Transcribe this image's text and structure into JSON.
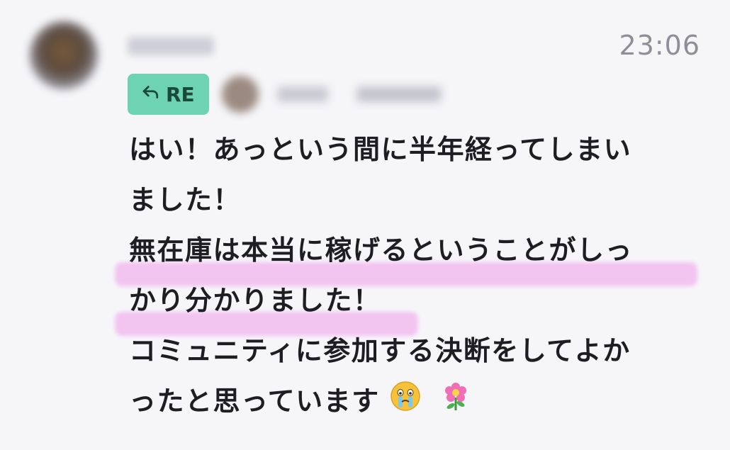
{
  "timestamp": "23:06",
  "reply_badge": {
    "label": "RE",
    "icon": "reply-arrow-icon",
    "color": "#6dd3b2"
  },
  "message": {
    "lines": [
      "はい！あっという間に半年経ってしまい",
      "ました！",
      "無在庫は本当に稼げるということがしっ",
      "かり分かりました！",
      "コミュニティに参加する決断をしてよか",
      "ったと思っています"
    ],
    "trailing_icons": [
      "crying-face-emoji",
      "flower-emoji"
    ],
    "highlight_color": "#f2b8ef"
  }
}
